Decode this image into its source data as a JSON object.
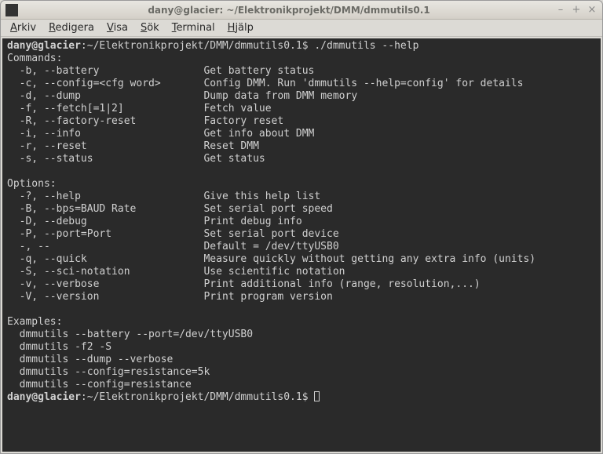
{
  "window": {
    "title": "dany@glacier: ~/Elektronikprojekt/DMM/dmmutils0.1"
  },
  "menubar": {
    "items": [
      {
        "label": "Arkiv",
        "accel": "A"
      },
      {
        "label": "Redigera",
        "accel": "R"
      },
      {
        "label": "Visa",
        "accel": "V"
      },
      {
        "label": "Sök",
        "accel": "S"
      },
      {
        "label": "Terminal",
        "accel": "T"
      },
      {
        "label": "Hjälp",
        "accel": "H"
      }
    ]
  },
  "terminal": {
    "prompt1_user": "dany@glacier",
    "prompt1_path": "~/Elektronikprojekt/DMM/dmmutils0.1",
    "prompt1_cmd": "./dmmutils --help",
    "sections": {
      "commands_header": "Commands:",
      "commands": [
        {
          "flag": "-b, --battery",
          "desc": "Get battery status"
        },
        {
          "flag": "-c, --config=<cfg word>",
          "desc": "Config DMM. Run 'dmmutils --help=config' for details"
        },
        {
          "flag": "-d, --dump",
          "desc": "Dump data from DMM memory"
        },
        {
          "flag": "-f, --fetch[=1|2]",
          "desc": "Fetch value"
        },
        {
          "flag": "-R, --factory-reset",
          "desc": "Factory reset"
        },
        {
          "flag": "-i, --info",
          "desc": "Get info about DMM"
        },
        {
          "flag": "-r, --reset",
          "desc": "Reset DMM"
        },
        {
          "flag": "-s, --status",
          "desc": "Get status"
        }
      ],
      "options_header": "Options:",
      "options": [
        {
          "flag": "-?, --help",
          "desc": "Give this help list"
        },
        {
          "flag": "-B, --bps=BAUD Rate",
          "desc": "Set serial port speed"
        },
        {
          "flag": "-D, --debug",
          "desc": "Print debug info"
        },
        {
          "flag": "-P, --port=Port",
          "desc": "Set serial port device"
        },
        {
          "flag": "-, --",
          "desc": "Default = /dev/ttyUSB0"
        },
        {
          "flag": "-q, --quick",
          "desc": "Measure quickly without getting any extra info (units)"
        },
        {
          "flag": "-S, --sci-notation",
          "desc": "Use scientific notation"
        },
        {
          "flag": "-v, --verbose",
          "desc": "Print additional info (range, resolution,...)"
        },
        {
          "flag": "-V, --version",
          "desc": "Print program version"
        }
      ],
      "examples_header": "Examples:",
      "examples": [
        "dmmutils --battery --port=/dev/ttyUSB0",
        "dmmutils -f2 -S",
        "dmmutils --dump --verbose",
        "dmmutils --config=resistance=5k",
        "dmmutils --config=resistance"
      ]
    },
    "prompt2_user": "dany@glacier",
    "prompt2_path": "~/Elektronikprojekt/DMM/dmmutils0.1"
  }
}
